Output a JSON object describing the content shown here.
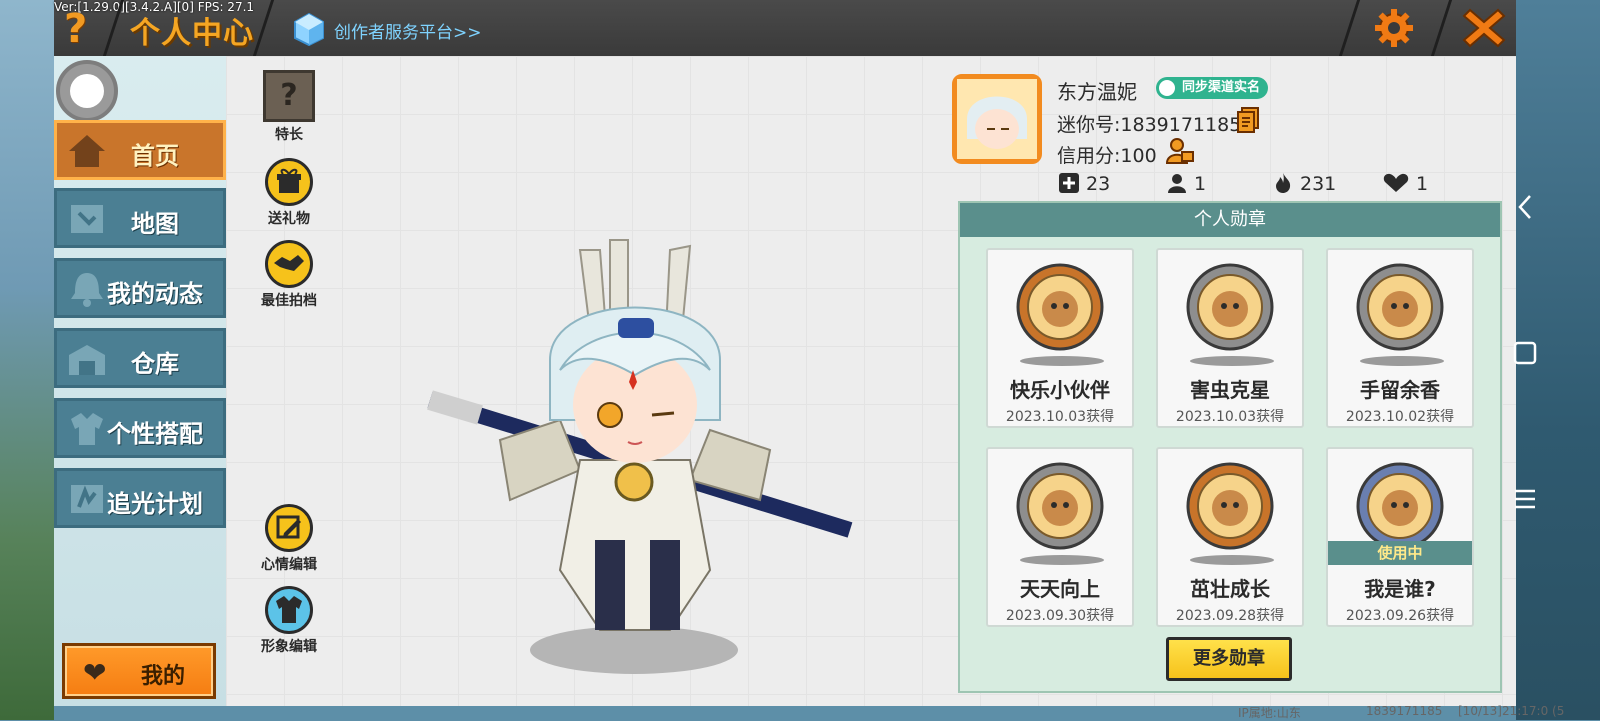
{
  "debug": {
    "version_text": "Ver:[1.29.0][3.4.2.A][0] FPS: 27.1"
  },
  "header": {
    "help_glyph": "?",
    "title": "个人中心",
    "creator_link": "创作者服务平台>>",
    "settings_icon": "gear-icon",
    "close_icon": "close-icon",
    "accent_color": "#f5a623"
  },
  "sidebar": {
    "items": [
      {
        "label": "首页",
        "icon": "house-icon",
        "active": true
      },
      {
        "label": "地图",
        "icon": "map-icon",
        "active": false
      },
      {
        "label": "我的动态",
        "icon": "bell-icon",
        "active": false
      },
      {
        "label": "仓库",
        "icon": "warehouse-icon",
        "active": false
      },
      {
        "label": "个性搭配",
        "icon": "outfit-icon",
        "active": false
      },
      {
        "label": "追光计划",
        "icon": "chase-light-icon",
        "active": false
      }
    ],
    "mine_button": {
      "label": "我的",
      "icon": "heart-icon"
    }
  },
  "actions": {
    "talent": {
      "label": "特长",
      "glyph": "?"
    },
    "send_gift": {
      "label": "送礼物",
      "icon": "gift-icon"
    },
    "best_partner": {
      "label": "最佳拍档",
      "icon": "handshake-icon"
    },
    "mood_edit": {
      "label": "心情编辑",
      "icon": "pencil-icon"
    },
    "avatar_edit": {
      "label": "形象编辑",
      "icon": "outfit-icon"
    }
  },
  "profile": {
    "nickname": "东方温妮",
    "verify_badge": "同步渠道实名",
    "mini_id": "迷你号:1839171185",
    "credit": "信用分:100",
    "stats": [
      {
        "icon": "friend-add-icon",
        "value": "23"
      },
      {
        "icon": "fans-icon",
        "value": "1"
      },
      {
        "icon": "flame-icon",
        "value": "231"
      },
      {
        "icon": "heart-icon",
        "value": "1"
      }
    ]
  },
  "badges": {
    "title": "个人勋章",
    "items": [
      {
        "name": "快乐小伙伴",
        "date": "2023.10.03获得",
        "rim": "#c8742a",
        "icon": "happy-friends-medal-icon",
        "in_use": false
      },
      {
        "name": "害虫克星",
        "date": "2023.10.03获得",
        "rim": "#8e8e8e",
        "icon": "pest-buster-medal-icon",
        "in_use": false
      },
      {
        "name": "手留余香",
        "date": "2023.10.02获得",
        "rim": "#8e8e8e",
        "icon": "fragrance-medal-icon",
        "in_use": false
      },
      {
        "name": "天天向上",
        "date": "2023.09.30获得",
        "rim": "#8e8e8e",
        "icon": "daily-progress-medal-icon",
        "in_use": false
      },
      {
        "name": "茁壮成长",
        "date": "2023.09.28获得",
        "rim": "#c8742a",
        "icon": "growth-medal-icon",
        "in_use": false
      },
      {
        "name": "我是谁?",
        "date": "2023.09.26获得",
        "rim": "#6a7fb0",
        "icon": "who-am-i-medal-icon",
        "in_use": true,
        "in_use_label": "使用中"
      }
    ],
    "more_button": "更多勋章"
  },
  "footer": {
    "ip": "IP属地:山东",
    "id": "1839171185",
    "time": "[10/13]21:17:0 (5"
  }
}
